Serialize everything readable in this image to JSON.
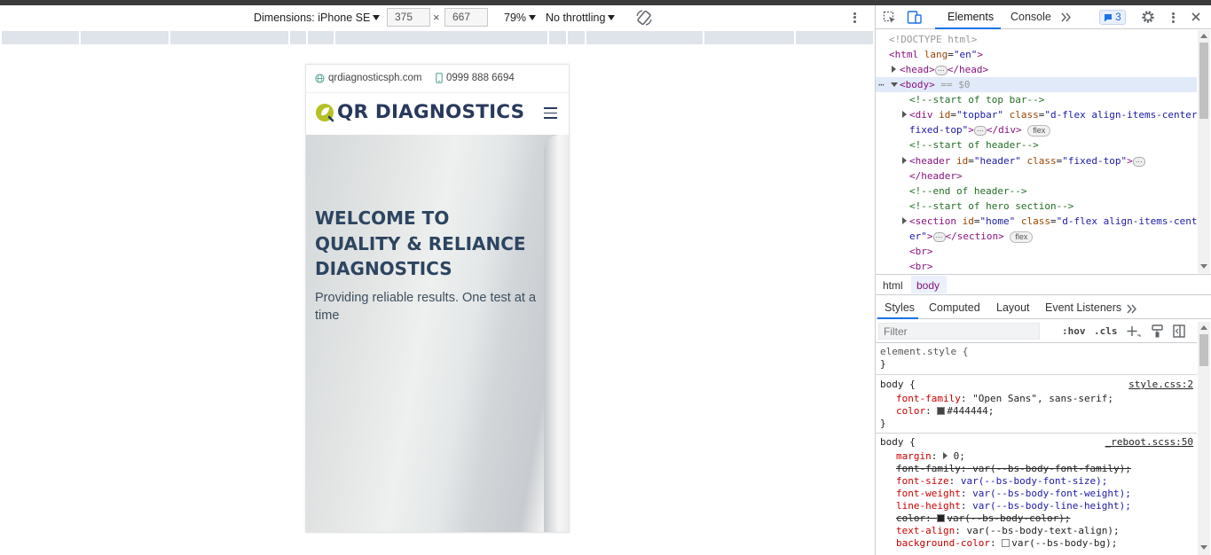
{
  "device_toolbar": {
    "dimensions_label": "Dimensions: iPhone SE",
    "width": "375",
    "times": "×",
    "height": "667",
    "zoom": "79%",
    "throttling": "No throttling"
  },
  "phone": {
    "topbar": {
      "website": "qrdiagnosticsph.com",
      "phone": "0999 888 6694"
    },
    "logo_text": "QR DIAGNOSTICS",
    "hero": {
      "title_l1": "WELCOME TO",
      "title_l2": "QUALITY & RELIANCE",
      "title_l3": "DIAGNOSTICS",
      "subtitle": "Providing reliable results. One test at a time"
    }
  },
  "devtools": {
    "tabs": {
      "elements": "Elements",
      "console": "Console"
    },
    "issues_count": "3",
    "dom": {
      "doctype": "<!DOCTYPE html>",
      "l_html_open": "<html",
      "l_html_attr": "lang",
      "l_html_val": "\"en\"",
      "l_head": "<head>",
      "l_head_close": "</head>",
      "l_body": "<body>",
      "l_body_eq": "== $0",
      "c_topbar": "<!--start of top bar-->",
      "div_tag": "<div",
      "div_id": "id",
      "div_id_val": "\"topbar\"",
      "div_class": "class",
      "div_class_val": "\"d-flex align-items-center",
      "div_class_val2": "fixed-top\"",
      "div_close": "</div>",
      "pill_flex": "flex",
      "c_header": "<!--start of header-->",
      "header_tag": "<header",
      "header_id_val": "\"header\"",
      "header_class_val": "\"fixed-top\"",
      "header_close": "</header>",
      "c_header_end": "<!--end of header-->",
      "c_hero": "<!--start of hero section-->",
      "section_tag": "<section",
      "section_id_val": "\"home\"",
      "section_class_val": "\"d-flex align-items-cent",
      "section_class_val2": "er\"",
      "section_close": "</section>",
      "br": "<br>"
    },
    "breadcrumbs": {
      "html": "html",
      "body": "body"
    },
    "style_tabs": {
      "styles": "Styles",
      "computed": "Computed",
      "layout": "Layout",
      "listeners": "Event Listeners"
    },
    "filter_placeholder": "Filter",
    "hov": ":hov",
    "cls": ".cls",
    "rules": {
      "element_style": "element.style {",
      "close": "}",
      "body_sel": "body {",
      "src1": "style.css:2",
      "ff_prop": "font-family",
      "ff_val": "\"Open Sans\", sans-serif;",
      "color_prop": "color",
      "color_val": "#444444;",
      "src2": "_reboot.scss:50",
      "margin_prop": "margin",
      "margin_val": "0;",
      "ff2_prop": "font-family",
      "ff2_val": "var(--bs-body-font-family);",
      "fs_prop": "font-size",
      "fs_val": "var(--bs-body-font-size);",
      "fw_prop": "font-weight",
      "fw_val": "var(--bs-body-font-weight);",
      "lh_prop": "line-height",
      "lh_val": "var(--bs-body-line-height);",
      "color2_prop": "color",
      "color2_val": "var(--bs-body-color);",
      "ta_prop": "text-align",
      "ta_val": "var(--bs-body-text-align);",
      "bg_prop": "background-color",
      "bg_val": "var(--bs-body-bg);"
    }
  },
  "colors": {
    "accent": "#1a73e8",
    "logo_navy": "#28385e",
    "logo_leaf": "#b5c124",
    "tag": "#881280"
  }
}
